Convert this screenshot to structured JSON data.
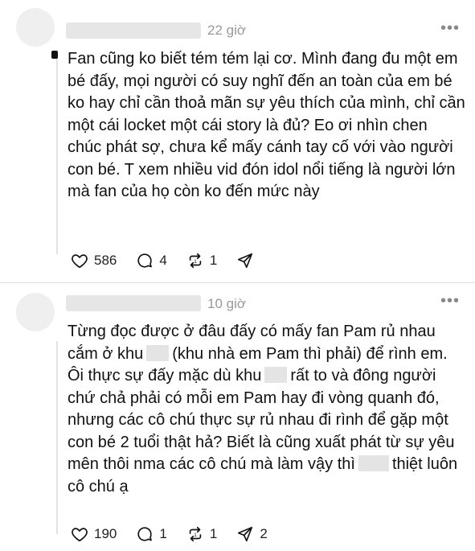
{
  "comments": [
    {
      "time": "22 giờ",
      "more_label": "•••",
      "text": "Fan cũng ko biết tém tém lại cơ. Mình đang đu một em bé đấy, mọi người có suy nghĩ đến an toàn của em bé ko hay chỉ cần thoả mãn sự yêu thích của mình, chỉ cần một cái locket một cái story là đủ? Eo ơi nhìn chen chúc phát sợ, chưa kể mấy cánh tay cố với vào người con bé. T xem nhiều vid đón idol nổi tiếng là người lớn mà fan của họ còn ko đến mức này",
      "likes": "586",
      "replies": "4",
      "reposts": "1",
      "shares": ""
    },
    {
      "time": "10 giờ",
      "more_label": "•••",
      "text_parts": [
        "Từng đọc được ở đâu đấy có mấy fan Pam rủ nhau cắm ở khu",
        "(khu nhà em Pam thì phải) để rình em. Ôi thực sự đấy mặc dù khu",
        "rất to và đông người chứ chả phải có mỗi em Pam hay đi vòng quanh đó, nhưng các cô chú thực sự rủ nhau đi rình để gặp một con bé 2 tuổi thật hả? Biết là cũng xuất phát từ sự yêu mên thôi nma các cô chú mà làm vậy thì",
        "thiệt luôn cô chú ạ"
      ],
      "likes": "190",
      "replies": "1",
      "reposts": "1",
      "shares": "2"
    }
  ],
  "icons": {
    "like": "heart-icon",
    "reply": "speech-bubble-icon",
    "repost": "repost-icon",
    "share": "send-icon"
  }
}
